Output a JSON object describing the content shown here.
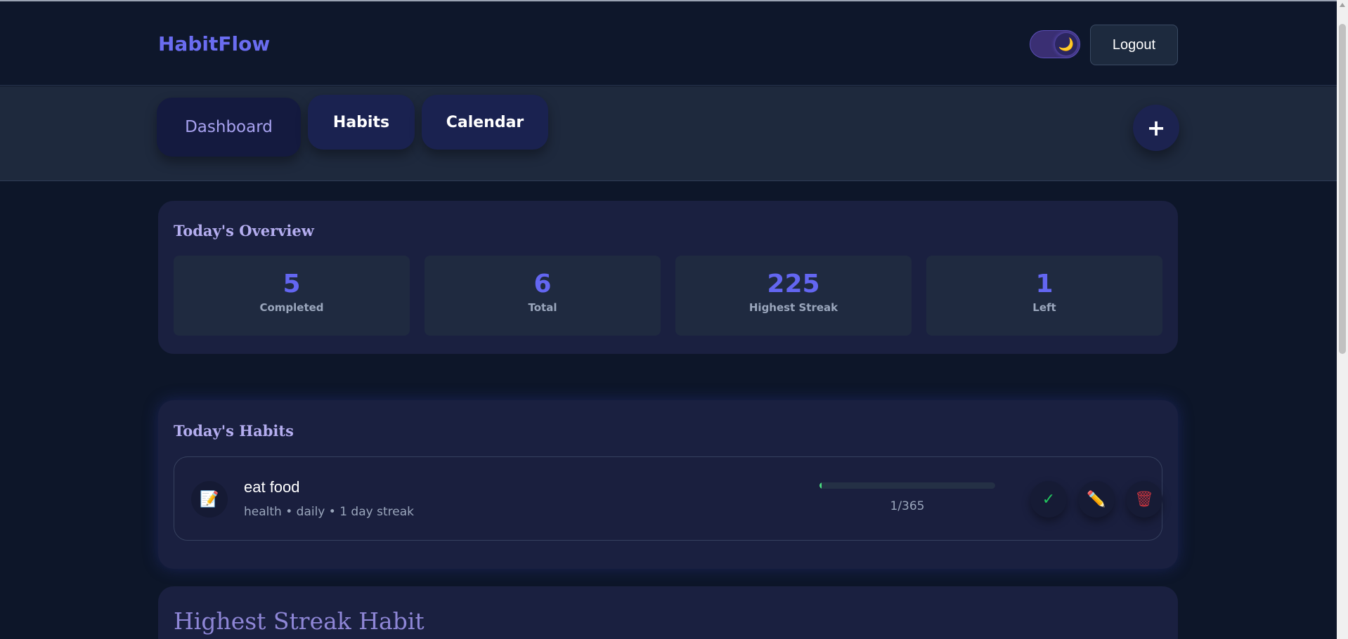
{
  "app": {
    "logo": "HabitFlow"
  },
  "header": {
    "theme_toggle_icon": "🌙",
    "logout_label": "Logout"
  },
  "nav": {
    "tabs": [
      {
        "label": "Dashboard",
        "active": true
      },
      {
        "label": "Habits",
        "active": false
      },
      {
        "label": "Calendar",
        "active": false
      }
    ],
    "add_label": "+"
  },
  "overview": {
    "title": "Today's Overview",
    "stats": [
      {
        "value": "5",
        "label": "Completed"
      },
      {
        "value": "6",
        "label": "Total"
      },
      {
        "value": "225",
        "label": "Highest Streak"
      },
      {
        "value": "1",
        "label": "Left"
      }
    ]
  },
  "todays_habits": {
    "title": "Today's Habits",
    "items": [
      {
        "icon": "📝",
        "name": "eat food",
        "meta": "health • daily • 1 day streak",
        "progress_text": "1/365",
        "progress_fraction": 0.0027,
        "complete_icon": "✓",
        "edit_icon": "✏️",
        "delete_icon": "🗑"
      }
    ]
  },
  "highest_streak": {
    "title": "Highest Streak Habit"
  },
  "colors": {
    "accent": "#6366f1",
    "background": "#0d1629",
    "card": "#1a2040",
    "success": "#22c55e",
    "warning": "#f5b700",
    "danger": "#c0343f"
  }
}
